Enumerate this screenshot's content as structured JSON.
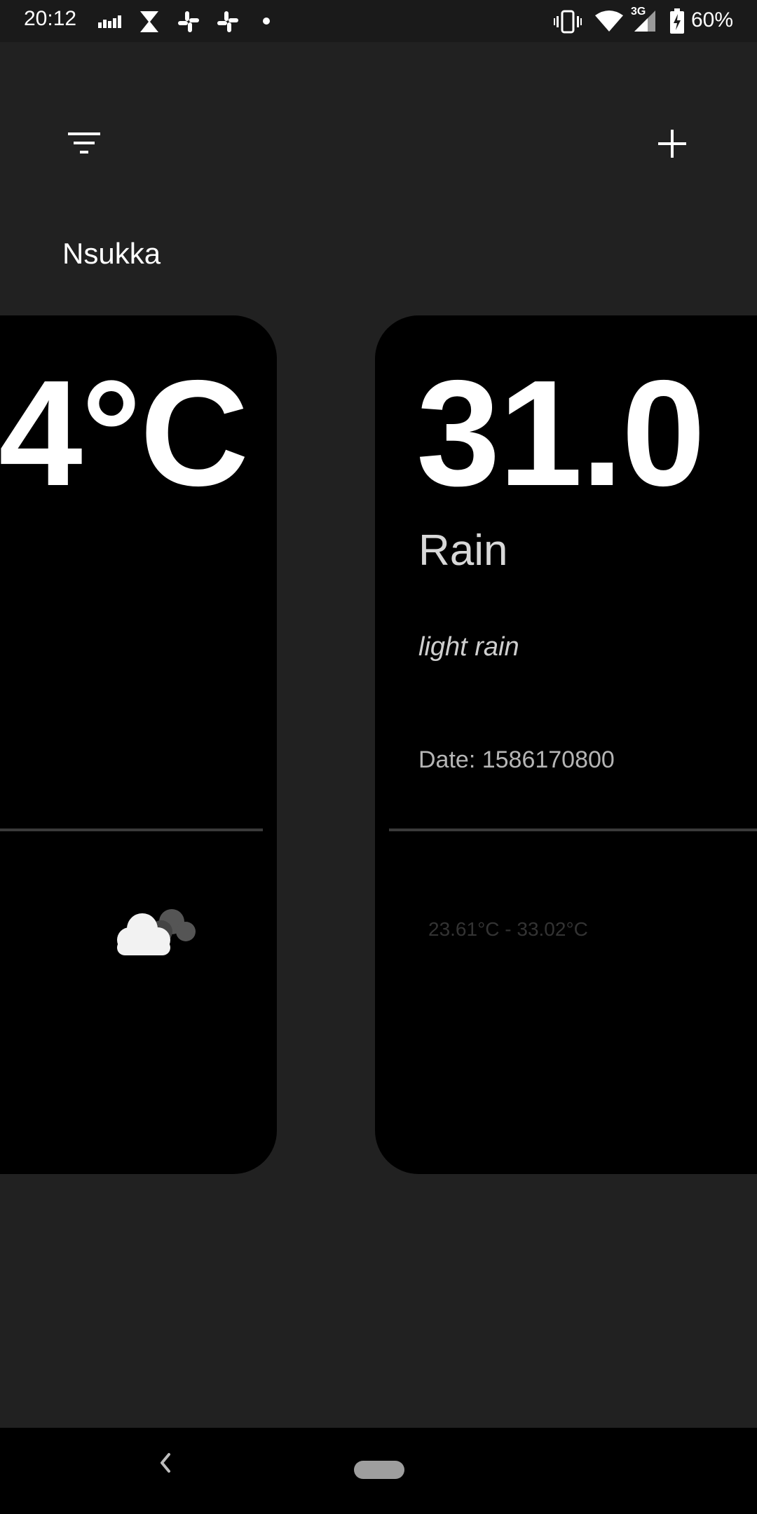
{
  "status_bar": {
    "time": "20:12",
    "network": "3G",
    "battery": "60%",
    "icons": [
      "signal-bars-icon",
      "hourglass-icon",
      "slack-icon",
      "slack-icon",
      "dot-icon",
      "vibrate-icon",
      "wifi-icon",
      "cellular-icon",
      "battery-charging-icon"
    ]
  },
  "toolbar": {
    "filter_icon": "filter-icon",
    "add_icon": "plus-icon"
  },
  "city": "Nsukka",
  "cards": [
    {
      "temperature_visible": "4°C",
      "weather_icon": "cloud-icon"
    },
    {
      "temperature_visible": "31.0",
      "condition": "Rain",
      "description": "light rain",
      "date": "Date: 1586170800",
      "range": "23.61°C - 33.02°C"
    }
  ],
  "nav_bar": {
    "back_icon": "back-chevron-icon",
    "home_icon": "home-pill-icon"
  },
  "colors": {
    "background": "#212121",
    "card": "#000000",
    "text_primary": "#ffffff"
  }
}
